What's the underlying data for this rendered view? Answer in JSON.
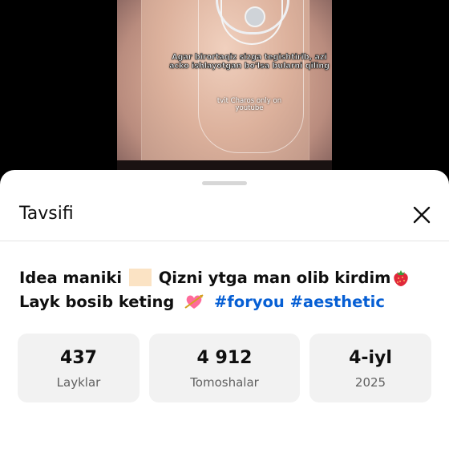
{
  "video": {
    "overlay_text": "Agar birortaqiz sizga tegishtirib, azi acko ishlayotgan bo'lsa bularni qiling",
    "credit": "tvit Charos only on youtube"
  },
  "sheet": {
    "title": "Tavsifi",
    "close_icon": "close-icon"
  },
  "description": {
    "part1": "Idea maniki",
    "part2": "Qizni ytga man olib kirdim",
    "part3": "Layk bosib keting",
    "hashtag1": "#foryou",
    "hashtag2": "#aesthetic",
    "emojis": [
      "skin-tone-swatch",
      "strawberry",
      "heart-with-arrow"
    ]
  },
  "stats": [
    {
      "value": "437",
      "label": "Layklar"
    },
    {
      "value": "4 912",
      "label": "Tomoshalar"
    },
    {
      "value": "4-iyl",
      "label": "2025"
    }
  ],
  "colors": {
    "hashtag": "#065fd4",
    "stat_bg": "#f2f2f2",
    "text": "#0f0f0f",
    "secondary_text": "#606060"
  }
}
